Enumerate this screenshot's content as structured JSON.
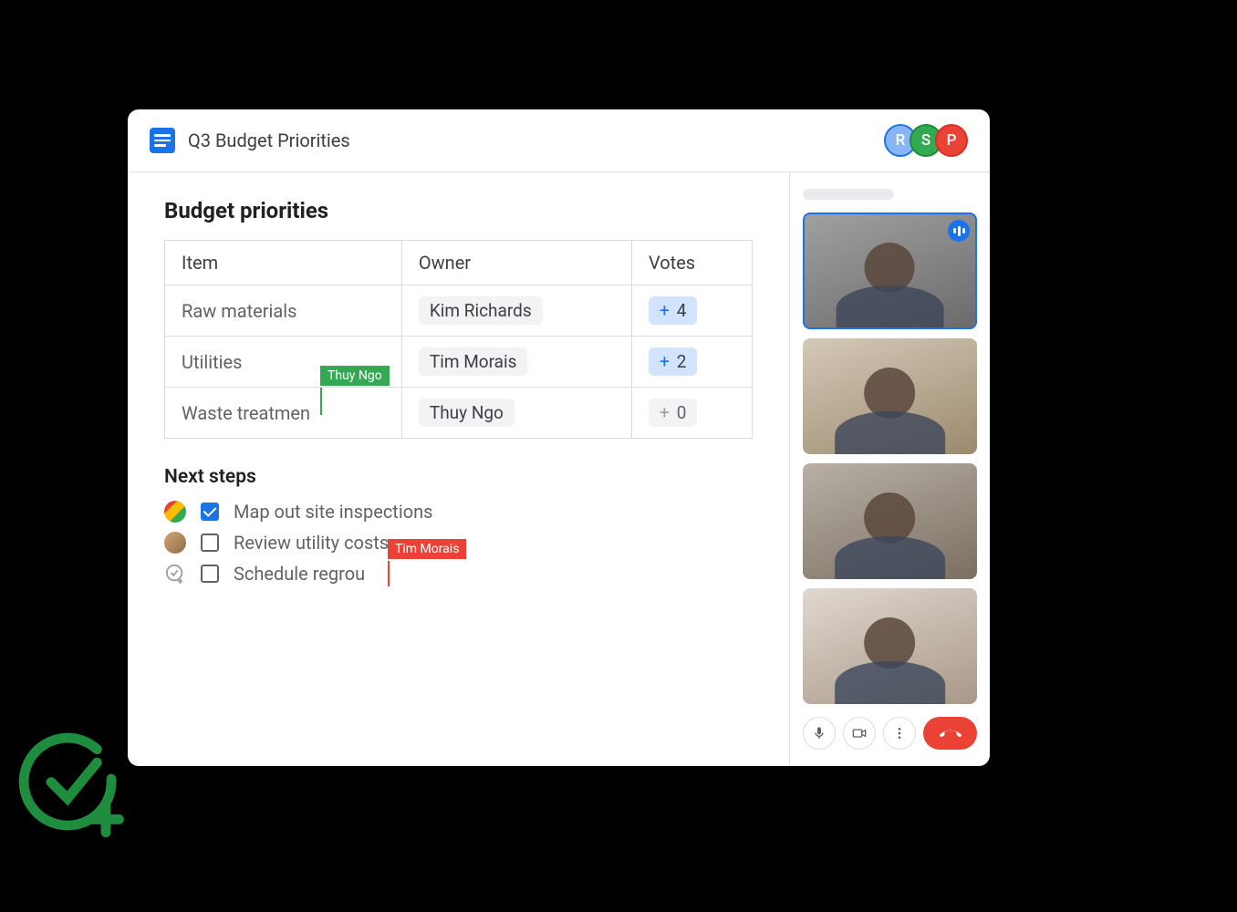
{
  "header": {
    "doc_title": "Q3 Budget Priorities",
    "collaborators": [
      {
        "initial": "R",
        "color": "blue"
      },
      {
        "initial": "S",
        "color": "green"
      },
      {
        "initial": "P",
        "color": "red"
      }
    ]
  },
  "section1": {
    "title": "Budget priorities",
    "columns": {
      "item": "Item",
      "owner": "Owner",
      "votes": "Votes"
    },
    "rows": [
      {
        "item": "Raw materials",
        "owner": "Kim Richards",
        "votes": 4,
        "active": true
      },
      {
        "item": "Utilities",
        "owner": "Tim Morais",
        "votes": 2,
        "active": true
      },
      {
        "item": "Waste treatmen",
        "owner": "Thuy Ngo",
        "votes": 0,
        "active": false
      }
    ],
    "cursor_label": "Thuy Ngo"
  },
  "section2": {
    "title": "Next steps",
    "items": [
      {
        "text": "Map out site inspections",
        "checked": true,
        "avatar": "multi"
      },
      {
        "text": "Review utility costs",
        "checked": false,
        "avatar": "single"
      },
      {
        "text": "Schedule regrou",
        "checked": false,
        "avatar": "assign"
      }
    ],
    "cursor_label": "Tim Morais"
  },
  "meet": {
    "participants": [
      {
        "speaking": true
      },
      {
        "speaking": false
      },
      {
        "speaking": false
      },
      {
        "speaking": false
      }
    ]
  }
}
